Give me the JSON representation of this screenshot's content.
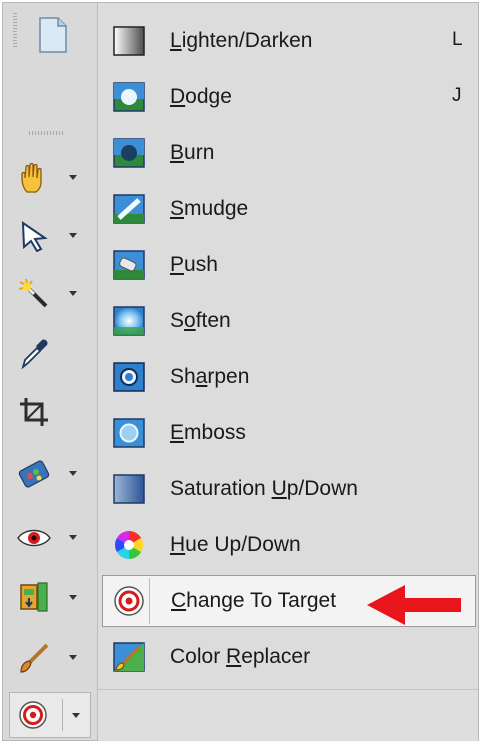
{
  "menu": {
    "items": [
      {
        "label_pre": "",
        "label_u": "L",
        "label_post": "ighten/Darken",
        "shortcut": "L",
        "icon": "lighten-darken-icon"
      },
      {
        "label_pre": "",
        "label_u": "D",
        "label_post": "odge",
        "shortcut": "J",
        "icon": "dodge-icon"
      },
      {
        "label_pre": "",
        "label_u": "B",
        "label_post": "urn",
        "shortcut": "",
        "icon": "burn-icon"
      },
      {
        "label_pre": "",
        "label_u": "S",
        "label_post": "mudge",
        "shortcut": "",
        "icon": "smudge-icon"
      },
      {
        "label_pre": "",
        "label_u": "P",
        "label_post": "ush",
        "shortcut": "",
        "icon": "push-icon"
      },
      {
        "label_pre": "S",
        "label_u": "o",
        "label_post": "ften",
        "shortcut": "",
        "icon": "soften-icon"
      },
      {
        "label_pre": "Sh",
        "label_u": "a",
        "label_post": "rpen",
        "shortcut": "",
        "icon": "sharpen-icon"
      },
      {
        "label_pre": "",
        "label_u": "E",
        "label_post": "mboss",
        "shortcut": "",
        "icon": "emboss-icon"
      },
      {
        "label_pre": "Saturation ",
        "label_u": "U",
        "label_post": "p/Down",
        "shortcut": "",
        "icon": "saturation-icon"
      },
      {
        "label_pre": "",
        "label_u": "H",
        "label_post": "ue Up/Down",
        "shortcut": "",
        "icon": "hue-icon"
      },
      {
        "label_pre": "",
        "label_u": "C",
        "label_post": "hange To Target",
        "shortcut": "",
        "icon": "change-to-target-icon"
      },
      {
        "label_pre": "Color ",
        "label_u": "R",
        "label_post": "eplacer",
        "shortcut": "",
        "icon": "color-replacer-icon"
      }
    ],
    "highlighted_index": 10
  },
  "toolbar": {
    "tools": [
      "new-document-icon",
      "pan-icon",
      "pick-icon",
      "magic-wand-icon",
      "dropper-icon",
      "crop-icon",
      "picture-tube-icon",
      "red-eye-icon",
      "flood-fill-icon",
      "paint-brush-icon",
      "change-to-target-icon"
    ]
  },
  "colors": {
    "callout_arrow": "#e8151b"
  }
}
